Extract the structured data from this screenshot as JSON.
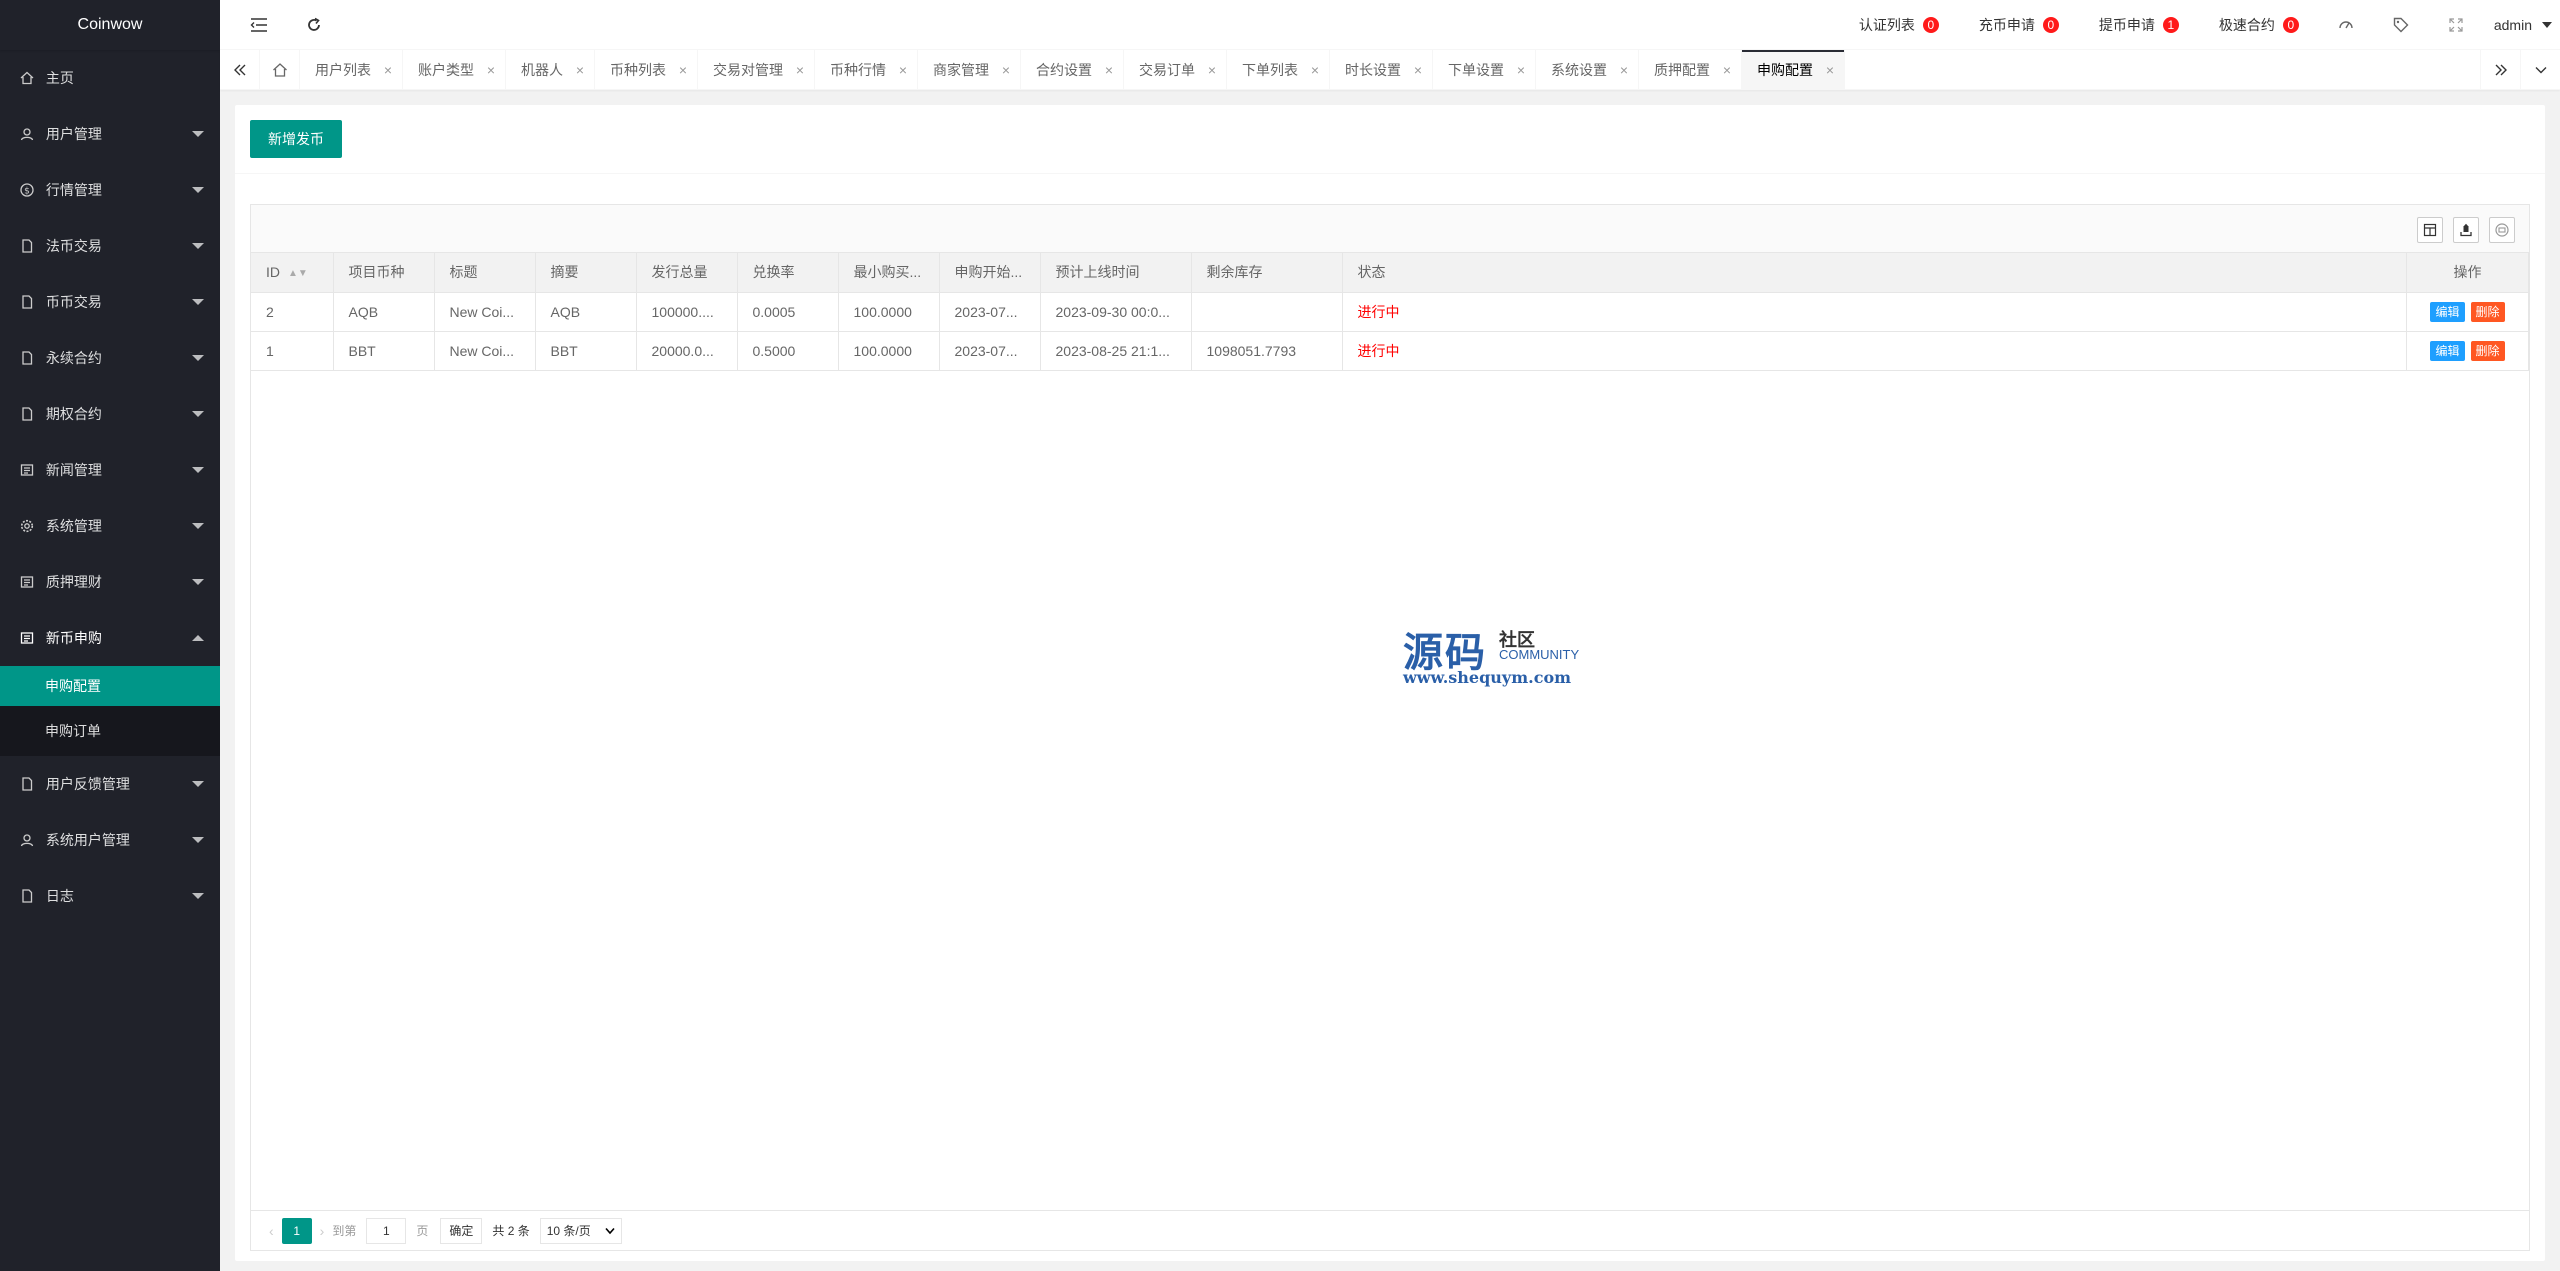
{
  "app": {
    "logo": "Coinwow"
  },
  "sidebar": {
    "items": [
      {
        "label": "主页",
        "icon": "home-icon"
      },
      {
        "label": "用户管理",
        "icon": "user-icon"
      },
      {
        "label": "行情管理",
        "icon": "dollar-icon"
      },
      {
        "label": "法币交易",
        "icon": "doc-icon"
      },
      {
        "label": "币币交易",
        "icon": "doc-icon"
      },
      {
        "label": "永续合约",
        "icon": "doc-icon"
      },
      {
        "label": "期权合约",
        "icon": "doc-icon"
      },
      {
        "label": "新闻管理",
        "icon": "news-icon"
      },
      {
        "label": "系统管理",
        "icon": "gear-icon"
      },
      {
        "label": "质押理财",
        "icon": "news-icon"
      },
      {
        "label": "新币申购",
        "icon": "news-icon"
      }
    ],
    "sub_items": [
      {
        "label": "申购配置"
      },
      {
        "label": "申购订单"
      }
    ],
    "bottom_items": [
      {
        "label": "用户反馈管理",
        "icon": "doc-icon"
      },
      {
        "label": "系统用户管理",
        "icon": "user-icon"
      },
      {
        "label": "日志",
        "icon": "doc-icon"
      }
    ]
  },
  "header": {
    "links": [
      {
        "label": "认证列表",
        "count": "0"
      },
      {
        "label": "充币申请",
        "count": "0"
      },
      {
        "label": "提币申请",
        "count": "1"
      },
      {
        "label": "极速合约",
        "count": "0"
      }
    ],
    "user": "admin"
  },
  "tabs": [
    {
      "label": "用户列表"
    },
    {
      "label": "账户类型"
    },
    {
      "label": "机器人"
    },
    {
      "label": "币种列表"
    },
    {
      "label": "交易对管理"
    },
    {
      "label": "币种行情"
    },
    {
      "label": "商家管理"
    },
    {
      "label": "合约设置"
    },
    {
      "label": "交易订单"
    },
    {
      "label": "下单列表"
    },
    {
      "label": "时长设置"
    },
    {
      "label": "下单设置"
    },
    {
      "label": "系统设置"
    },
    {
      "label": "质押配置"
    },
    {
      "label": "申购配置"
    }
  ],
  "main": {
    "add_button": "新增发币",
    "table": {
      "headers": [
        "ID",
        "项目币种",
        "标题",
        "摘要",
        "发行总量",
        "兑换率",
        "最小购买...",
        "申购开始...",
        "预计上线时间",
        "剩余库存",
        "状态",
        "操作"
      ],
      "rows": [
        {
          "id": "2",
          "coin": "AQB",
          "title": "New Coi...",
          "summary": "AQB",
          "total": "100000....",
          "rate": "0.0005",
          "min": "100.0000",
          "start": "2023-07...",
          "online": "2023-09-30 00:0...",
          "stock": "",
          "status": "进行中"
        },
        {
          "id": "1",
          "coin": "BBT",
          "title": "New Coi...",
          "summary": "BBT",
          "total": "20000.0...",
          "rate": "0.5000",
          "min": "100.0000",
          "start": "2023-07...",
          "online": "2023-08-25 21:1...",
          "stock": "1098051.7793",
          "status": "进行中"
        }
      ],
      "edit_label": "编辑",
      "delete_label": "删除"
    },
    "pager": {
      "current": "1",
      "goto_label": "到第",
      "goto_value": "1",
      "page_unit": "页",
      "ok_label": "确定",
      "total": "共 2 条",
      "page_size": "10 条/页"
    }
  },
  "watermark": {
    "main": "源码",
    "side": "社区",
    "community": "COMMUNITY",
    "url": "www.shequym.com"
  }
}
